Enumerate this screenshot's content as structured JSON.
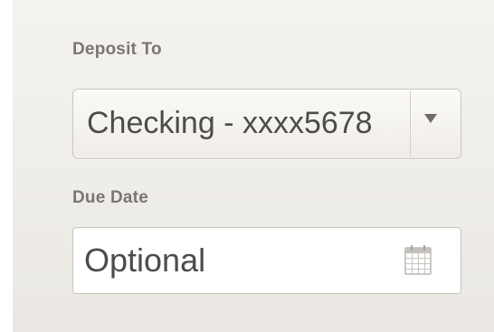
{
  "deposit": {
    "label": "Deposit To",
    "selected_value": "Checking - xxxx5678",
    "dropdown_icon": "chevron-down-icon"
  },
  "due_date": {
    "label": "Due Date",
    "placeholder": "Optional",
    "value": "",
    "calendar_icon": "calendar-icon"
  },
  "colors": {
    "panel_background": "#efede9",
    "label_text": "#7a7772",
    "field_text": "#4e4c49",
    "field_border": "#c9c6c1"
  }
}
